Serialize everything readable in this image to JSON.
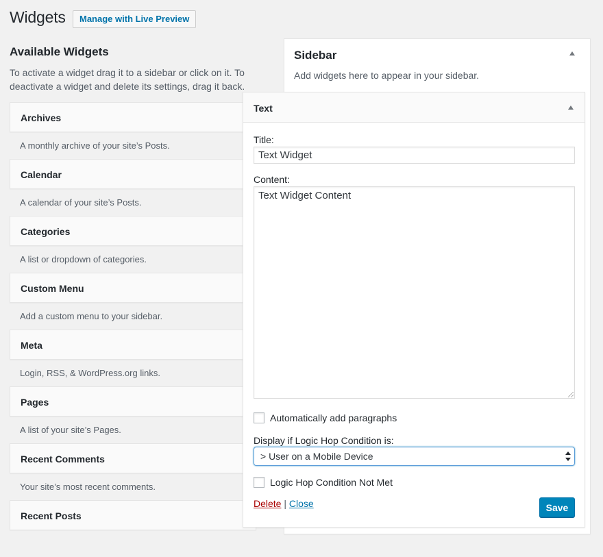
{
  "page": {
    "title": "Widgets",
    "live_preview_button": "Manage with Live Preview"
  },
  "available": {
    "title": "Available Widgets",
    "description": "To activate a widget drag it to a sidebar or click on it. To deactivate a widget and delete its settings, drag it back.",
    "widgets": [
      {
        "title": "Archives",
        "description": "A monthly archive of your site’s Posts."
      },
      {
        "title": "Calendar",
        "description": "A calendar of your site’s Posts."
      },
      {
        "title": "Categories",
        "description": "A list or dropdown of categories."
      },
      {
        "title": "Custom Menu",
        "description": "Add a custom menu to your sidebar."
      },
      {
        "title": "Meta",
        "description": "Login, RSS, & WordPress.org links."
      },
      {
        "title": "Pages",
        "description": "A list of your site’s Pages."
      },
      {
        "title": "Recent Comments",
        "description": "Your site’s most recent comments."
      },
      {
        "title": "Recent Posts",
        "description": ""
      }
    ]
  },
  "sidebar": {
    "title": "Sidebar",
    "description": "Add widgets here to appear in your sidebar."
  },
  "text_widget": {
    "header": "Text",
    "title_label": "Title:",
    "title_value": "Text Widget",
    "content_label": "Content:",
    "content_value": "Text Widget Content",
    "auto_paragraphs_label": "Automatically add paragraphs",
    "auto_paragraphs_checked": false,
    "condition_label": "Display if Logic Hop Condition is:",
    "condition_value": "> User on a Mobile Device",
    "not_met_label": "Logic Hop Condition Not Met",
    "not_met_checked": false,
    "delete_label": "Delete",
    "separator": "|",
    "close_label": "Close",
    "save_label": "Save"
  },
  "colors": {
    "background": "#f1f1f1",
    "link": "#0073aa",
    "delete": "#aa0000",
    "primary_button": "#0085ba",
    "focus_border": "#5b9dd9"
  },
  "icons": {
    "collapse": "triangle-up-icon",
    "select": "select-arrows-icon",
    "resize": "resize-grip-icon"
  }
}
